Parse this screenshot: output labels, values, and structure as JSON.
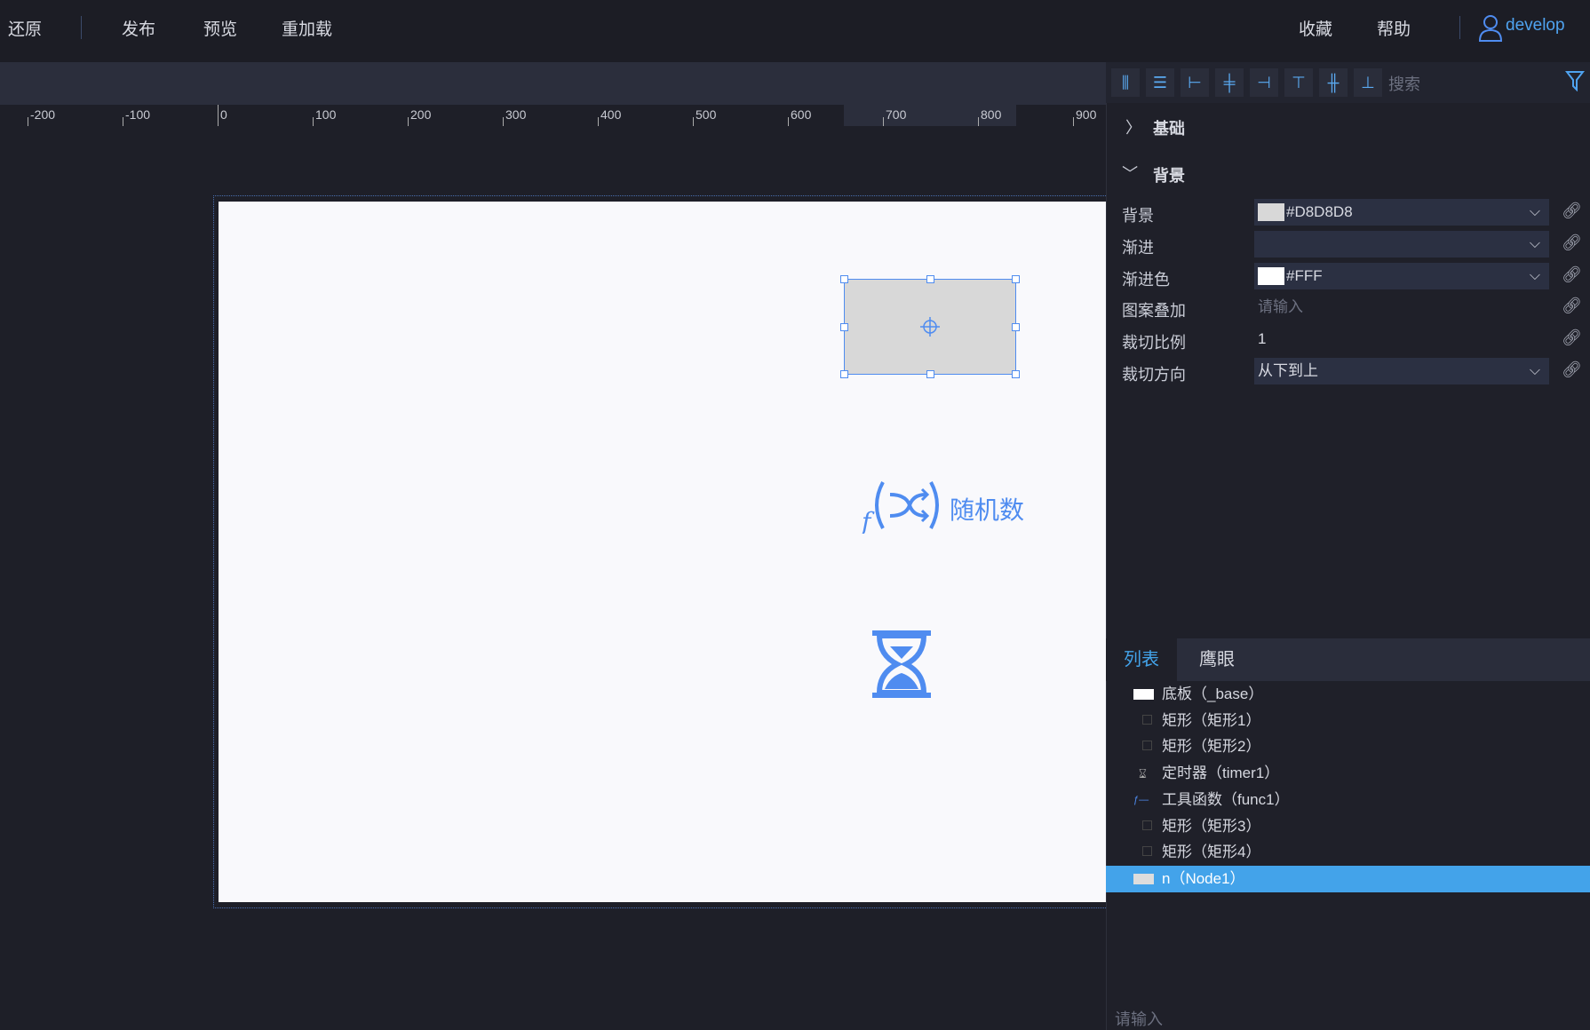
{
  "topbar": {
    "left": [
      "还原",
      "发布",
      "预览",
      "重加载"
    ],
    "right": [
      "收藏",
      "帮助"
    ],
    "user": "develop"
  },
  "ruler": [
    "-200",
    "-100",
    "0",
    "100",
    "200",
    "300",
    "400",
    "500",
    "600",
    "700",
    "800",
    "900"
  ],
  "canvas": {
    "func_label": "随机数"
  },
  "toolbar": {
    "search_placeholder": "搜索"
  },
  "sections": {
    "basic": "基础",
    "background": "背景"
  },
  "props": [
    {
      "label": "背景",
      "value": "#D8D8D8",
      "swatch": "#D8D8D8",
      "type": "select"
    },
    {
      "label": "渐进",
      "value": "",
      "type": "select"
    },
    {
      "label": "渐进色",
      "value": "#FFF",
      "swatch": "#FFFFFF",
      "type": "select"
    },
    {
      "label": "图案叠加",
      "placeholder": "请输入",
      "type": "input"
    },
    {
      "label": "裁切比例",
      "value": "1",
      "type": "input"
    },
    {
      "label": "裁切方向",
      "value": "从下到上",
      "type": "select"
    }
  ],
  "tabs": [
    "列表",
    "鹰眼"
  ],
  "layers": [
    "底板（_base）",
    "矩形（矩形1）",
    "矩形（矩形2）",
    "定时器（timer1）",
    "工具函数（func1）",
    "矩形（矩形3）",
    "矩形（矩形4）",
    "n（Node1）"
  ],
  "bottom_input": {
    "placeholder": "请输入"
  },
  "colors": {
    "accent": "#43a3ea",
    "icon": "#4f8cf0"
  }
}
